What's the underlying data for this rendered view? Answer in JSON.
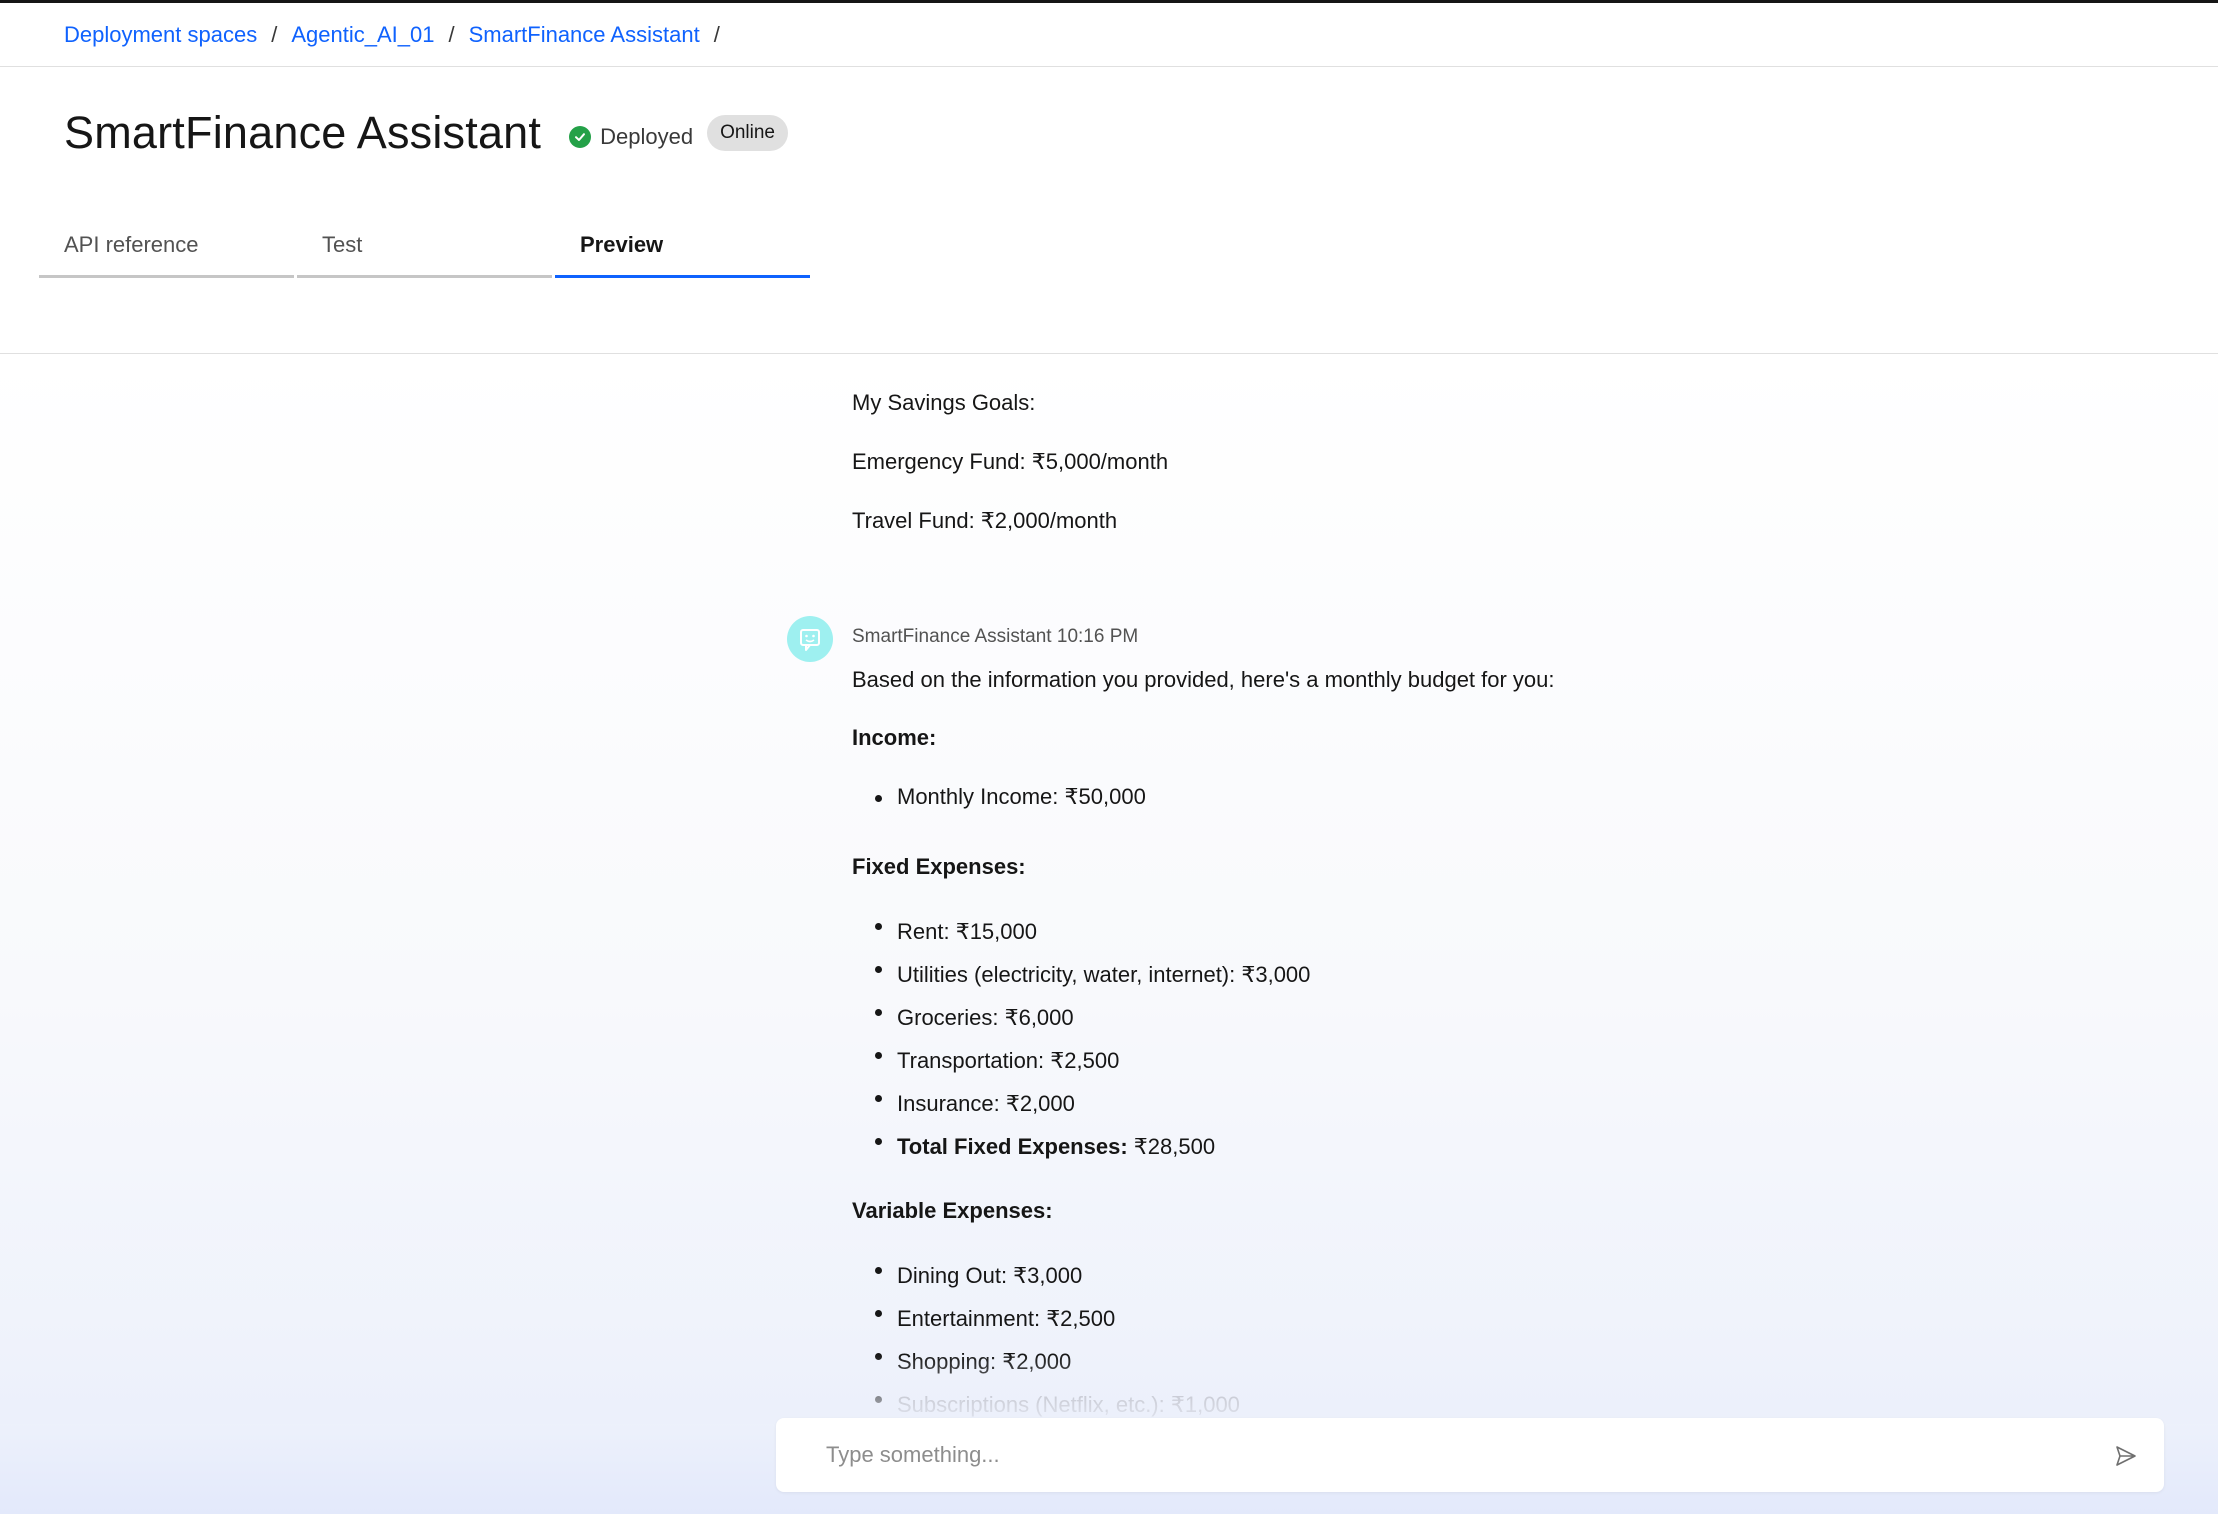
{
  "breadcrumb": {
    "items": [
      "Deployment spaces",
      "Agentic_AI_01",
      "SmartFinance Assistant"
    ],
    "separator": "/"
  },
  "header": {
    "title": "SmartFinance Assistant",
    "status": "Deployed",
    "badge": "Online"
  },
  "tabs": [
    {
      "label": "API reference",
      "active": false
    },
    {
      "label": "Test",
      "active": false
    },
    {
      "label": "Preview",
      "active": true
    }
  ],
  "chat": {
    "user_tail": [
      "My Savings Goals:",
      "Emergency Fund: ₹5,000/month",
      "Travel Fund: ₹2,000/month"
    ],
    "assistant": {
      "sender": "SmartFinance Assistant",
      "time": "10:16 PM",
      "intro": "Based on the information you provided, here's a monthly budget for you:",
      "income_heading": "Income:",
      "income_items": [
        "Monthly Income: ₹50,000"
      ],
      "fixed_heading": "Fixed Expenses:",
      "fixed_items": [
        "Rent: ₹15,000",
        "Utilities (electricity, water, internet): ₹3,000",
        "Groceries: ₹6,000",
        "Transportation: ₹2,500",
        "Insurance: ₹2,000"
      ],
      "fixed_total_label": "Total Fixed Expenses:",
      "fixed_total_value": "₹28,500",
      "variable_heading": "Variable Expenses:",
      "variable_items": [
        "Dining Out: ₹3,000",
        "Entertainment: ₹2,500",
        "Shopping: ₹2,000",
        "Subscriptions (Netflix, etc.): ₹1,000"
      ]
    }
  },
  "composer": {
    "placeholder": "Type something..."
  },
  "colors": {
    "link": "#0f62fe",
    "status_ok": "#24a148",
    "avatar_bg": "#9ef0f0",
    "tab_active": "#0f62fe"
  },
  "icons": {
    "status": "checkmark-filled-icon",
    "avatar": "chatbot-icon",
    "send": "send-icon"
  }
}
